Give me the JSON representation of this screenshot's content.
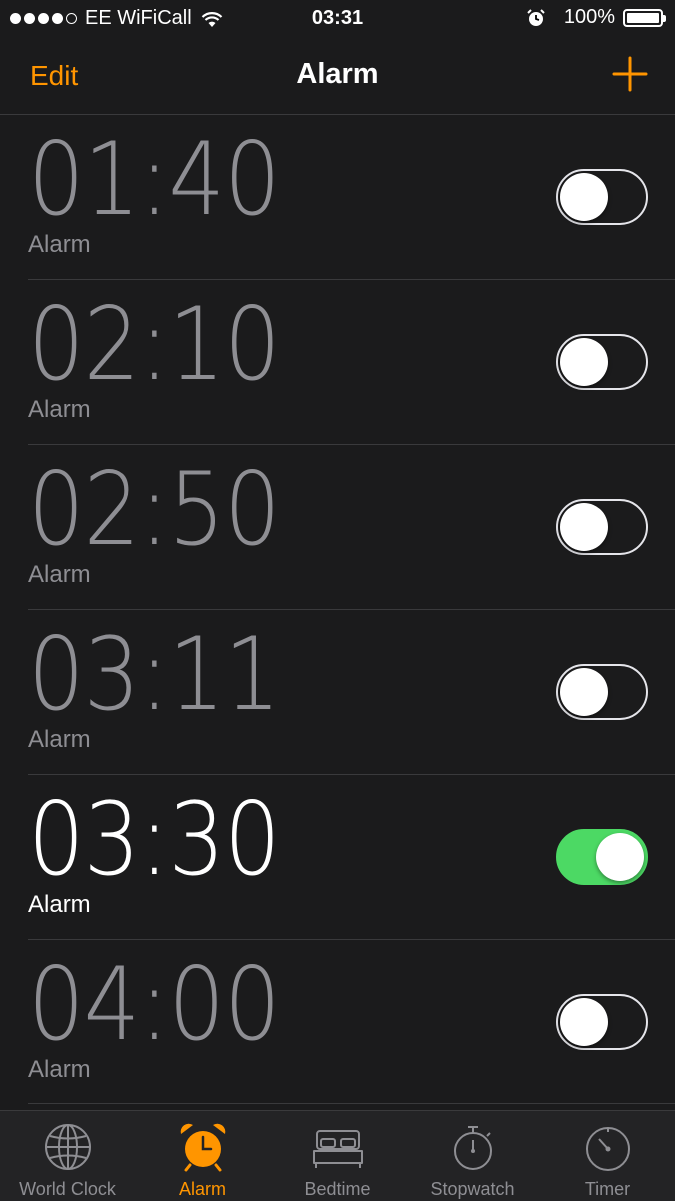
{
  "status_bar": {
    "carrier": "EE WiFiCall",
    "time": "03:31",
    "battery": "100%",
    "signal_bars_filled": 4,
    "signal_bars_total": 5
  },
  "nav": {
    "edit_label": "Edit",
    "title": "Alarm",
    "add_icon": "plus-icon"
  },
  "alarms": [
    {
      "time": "01:40",
      "label": "Alarm",
      "enabled": false
    },
    {
      "time": "02:10",
      "label": "Alarm",
      "enabled": false
    },
    {
      "time": "02:50",
      "label": "Alarm",
      "enabled": false
    },
    {
      "time": "03:11",
      "label": "Alarm",
      "enabled": false
    },
    {
      "time": "03:30",
      "label": "Alarm",
      "enabled": true
    },
    {
      "time": "04:00",
      "label": "Alarm",
      "enabled": false
    }
  ],
  "tabs": [
    {
      "label": "World Clock",
      "icon": "globe-icon",
      "active": false
    },
    {
      "label": "Alarm",
      "icon": "alarm-clock-icon",
      "active": true
    },
    {
      "label": "Bedtime",
      "icon": "bed-icon",
      "active": false
    },
    {
      "label": "Stopwatch",
      "icon": "stopwatch-icon",
      "active": false
    },
    {
      "label": "Timer",
      "icon": "timer-icon",
      "active": false
    }
  ],
  "colors": {
    "accent": "#ff9500",
    "toggle_on": "#4cd964",
    "inactive_text": "#8e8e93",
    "background": "#1b1b1c"
  }
}
